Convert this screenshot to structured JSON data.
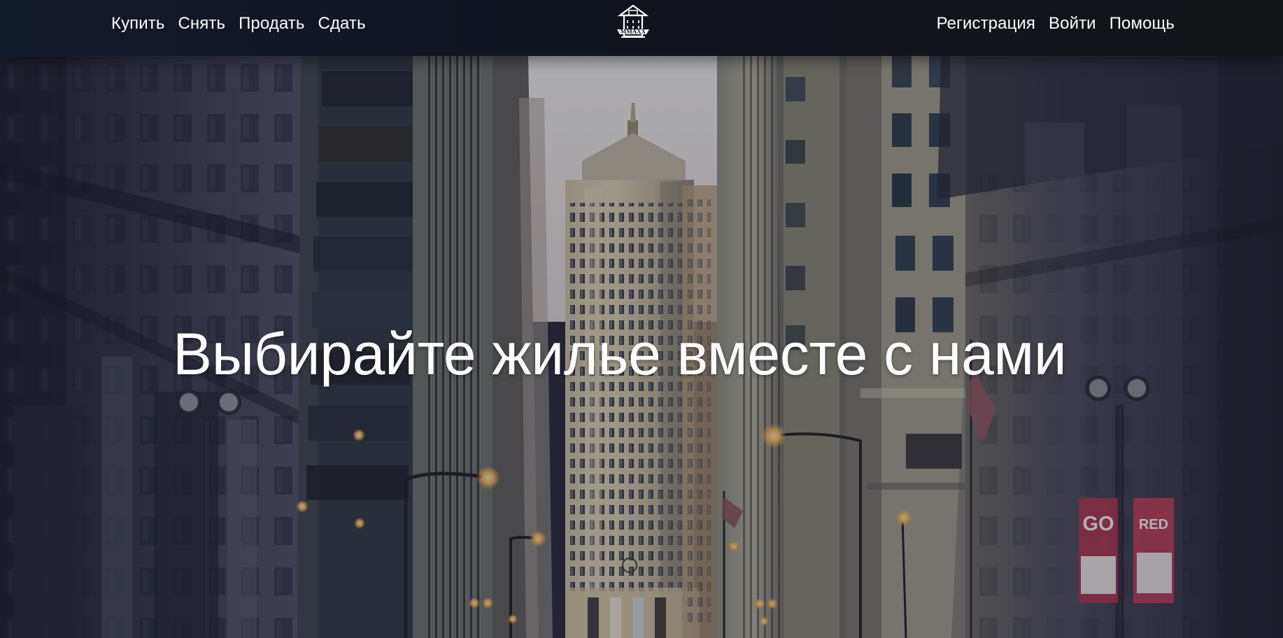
{
  "nav": {
    "left_links": [
      "Купить",
      "Снять",
      "Продать",
      "Сдать"
    ],
    "right_links": [
      "Регистрация",
      "Войти",
      "Помощь"
    ],
    "logo_text": "MMAXX"
  },
  "hero": {
    "heading": "Выбирайте жилье вместе с нами",
    "banner_left": "GO",
    "banner_right": "RED"
  },
  "theme": {
    "nav_background": "#11151f",
    "hero_overlay": "#252636",
    "text": "#ffffff",
    "street_light": "#ffd081",
    "banner_red": "#b4304b"
  },
  "icons": {
    "logo": "house-logo-icon"
  }
}
